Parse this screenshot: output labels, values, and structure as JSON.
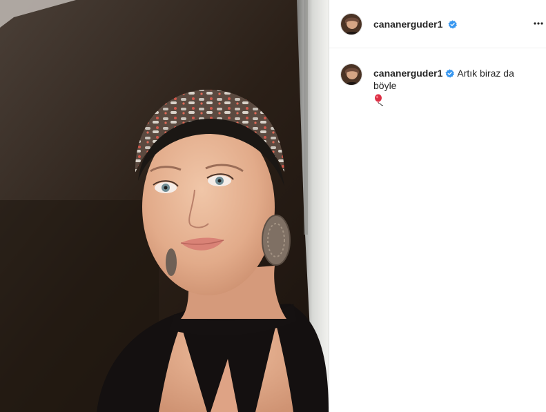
{
  "post": {
    "author": {
      "username": "cananerguder1",
      "verified": true,
      "avatar_icon": "profile-photo-avatar"
    },
    "header": {
      "more_icon": "more-options-icon"
    },
    "caption": {
      "username": "cananerguder1",
      "text": "Artık biraz da böyle",
      "emoji_icon": "balloon-emoji"
    }
  },
  "colors": {
    "text": "#262626",
    "verified_badge": "#3897f0",
    "divider": "#efefef",
    "border": "#dbdbdb"
  }
}
